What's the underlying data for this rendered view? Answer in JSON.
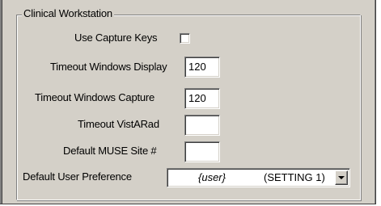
{
  "group": {
    "title": "Clinical Workstation"
  },
  "fields": {
    "use_capture_keys": {
      "label": "Use Capture Keys",
      "checked": false
    },
    "timeout_windows_display": {
      "label": "Timeout Windows Display",
      "value": "120"
    },
    "timeout_windows_capture": {
      "label": "Timeout Windows Capture",
      "value": "120"
    },
    "timeout_vistarad": {
      "label": "Timeout VistARad",
      "value": ""
    },
    "default_muse_site": {
      "label": "Default MUSE Site #",
      "value": ""
    },
    "default_user_preference": {
      "label": "Default User Preference",
      "selected_user": "{user}",
      "selected_setting": "(SETTING 1)"
    }
  },
  "icons": {
    "combo_dropdown": "chevron-down-icon"
  }
}
